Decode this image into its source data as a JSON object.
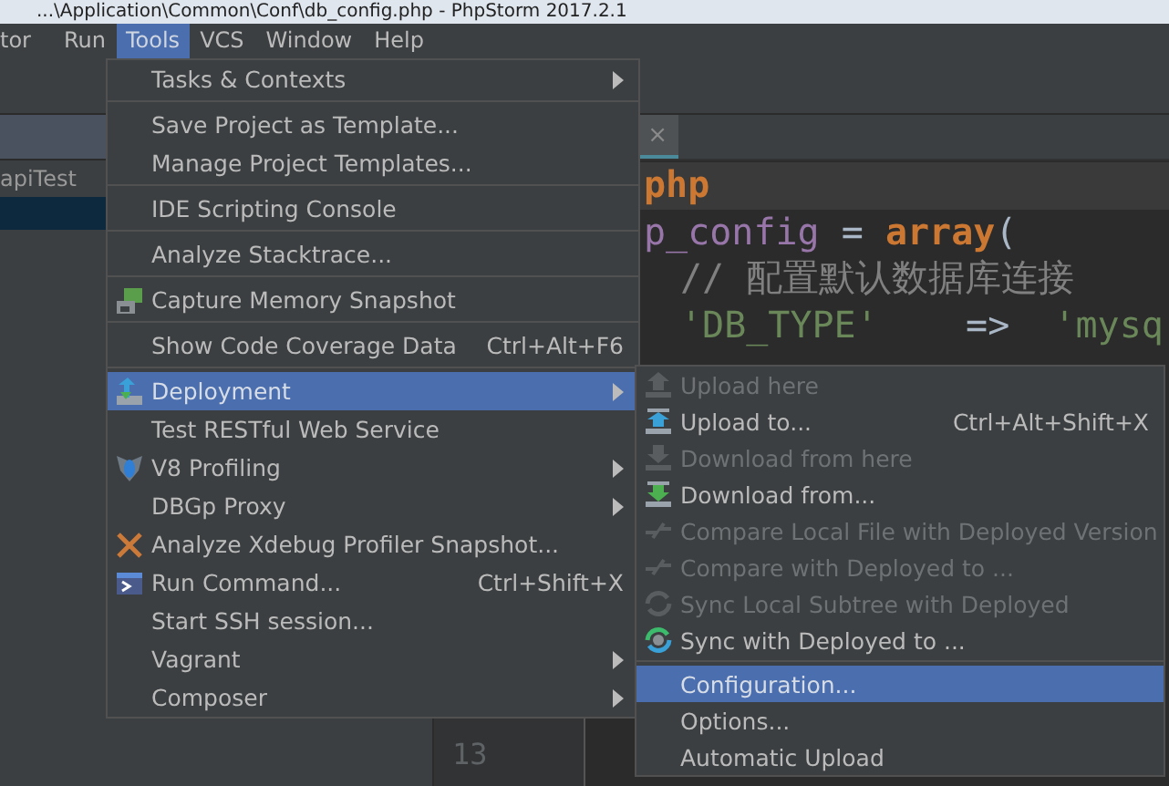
{
  "window": {
    "title": "...\\Application\\Common\\Conf\\db_config.php - PhpStorm 2017.2.1"
  },
  "menu_bar": [
    {
      "label": "tor",
      "selected": false
    },
    {
      "label": "Run",
      "selected": false
    },
    {
      "label": "Tools",
      "selected": true
    },
    {
      "label": "VCS",
      "selected": false
    },
    {
      "label": "Window",
      "selected": false
    },
    {
      "label": "Help",
      "selected": false
    }
  ],
  "project_panel": {
    "items": [
      {
        "label": "apiTest",
        "selected": false
      },
      {
        "selected": true
      }
    ]
  },
  "editor": {
    "tab_close": "×",
    "code_lines": [
      {
        "indent": false,
        "highlighted": true,
        "tokens": [
          {
            "text": "php",
            "kind": "keyword"
          }
        ]
      },
      {
        "indent": false,
        "highlighted": false,
        "tokens": [
          {
            "text": "p_config",
            "kind": "variable"
          },
          {
            "text": " = ",
            "kind": "plain"
          },
          {
            "text": "array",
            "kind": "keyword"
          },
          {
            "text": "(",
            "kind": "plain"
          }
        ]
      },
      {
        "indent": true,
        "highlighted": false,
        "tokens": [
          {
            "text": "// 配置默认数据库连接",
            "kind": "comment"
          }
        ]
      },
      {
        "indent": true,
        "highlighted": false,
        "tokens": [
          {
            "text": "'DB_TYPE'",
            "kind": "string"
          },
          {
            "text": "    =>  ",
            "kind": "plain"
          },
          {
            "text": "'mysq",
            "kind": "string"
          }
        ]
      }
    ],
    "line_number": "13"
  },
  "tools_menu": [
    {
      "kind": "item",
      "label": "Tasks & Contexts",
      "submenu": true,
      "selected": false
    },
    {
      "kind": "separator"
    },
    {
      "kind": "item",
      "label": "Save Project as Template...",
      "selected": false
    },
    {
      "kind": "item",
      "label": "Manage Project Templates...",
      "selected": false
    },
    {
      "kind": "separator"
    },
    {
      "kind": "item",
      "label": "IDE Scripting Console",
      "selected": false
    },
    {
      "kind": "separator"
    },
    {
      "kind": "item",
      "label": "Analyze Stacktrace...",
      "selected": false
    },
    {
      "kind": "separator"
    },
    {
      "kind": "item",
      "label": "Capture Memory Snapshot",
      "selected": false
    },
    {
      "kind": "separator"
    },
    {
      "kind": "item",
      "label": "Show Code Coverage Data",
      "shortcut": "Ctrl+Alt+F6",
      "selected": false
    },
    {
      "kind": "separator"
    },
    {
      "kind": "item",
      "label": "Deployment",
      "submenu": true,
      "selected": true
    },
    {
      "kind": "item",
      "label": "Test RESTful Web Service",
      "selected": false
    },
    {
      "kind": "item",
      "label": "V8 Profiling",
      "submenu": true,
      "selected": false
    },
    {
      "kind": "item",
      "label": "DBGp Proxy",
      "submenu": true,
      "selected": false
    },
    {
      "kind": "item",
      "label": "Analyze Xdebug Profiler Snapshot...",
      "selected": false
    },
    {
      "kind": "item",
      "label": "Run Command...",
      "shortcut": "Ctrl+Shift+X",
      "selected": false
    },
    {
      "kind": "item",
      "label": "Start SSH session...",
      "selected": false
    },
    {
      "kind": "item",
      "label": "Vagrant",
      "submenu": true,
      "selected": false
    },
    {
      "kind": "item",
      "label": "Composer",
      "submenu": true,
      "selected": false
    }
  ],
  "deployment_submenu": [
    {
      "kind": "item",
      "label": "Upload here",
      "disabled": true,
      "selected": false
    },
    {
      "kind": "item",
      "label": "Upload to...",
      "shortcut": "Ctrl+Alt+Shift+X",
      "disabled": false,
      "selected": false
    },
    {
      "kind": "item",
      "label": "Download from here",
      "disabled": true,
      "selected": false
    },
    {
      "kind": "item",
      "label": "Download from...",
      "disabled": false,
      "selected": false
    },
    {
      "kind": "item",
      "label": "Compare Local File with Deployed Version",
      "disabled": true,
      "selected": false
    },
    {
      "kind": "item",
      "label": "Compare with Deployed to ...",
      "disabled": true,
      "selected": false
    },
    {
      "kind": "item",
      "label": "Sync Local Subtree with Deployed",
      "disabled": true,
      "selected": false
    },
    {
      "kind": "item",
      "label": "Sync with Deployed to ...",
      "disabled": false,
      "selected": false
    },
    {
      "kind": "separator"
    },
    {
      "kind": "item",
      "label": "Configuration...",
      "disabled": false,
      "selected": true
    },
    {
      "kind": "item",
      "label": "Options...",
      "disabled": false,
      "selected": false
    },
    {
      "kind": "item",
      "label": "Automatic Upload",
      "disabled": false,
      "selected": false
    }
  ]
}
